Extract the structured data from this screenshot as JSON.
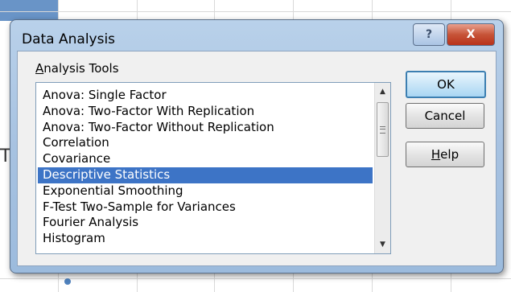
{
  "dialog": {
    "title": "Data Analysis",
    "help_glyph": "?",
    "close_glyph": "X",
    "tools_label_prefix": "",
    "tools_label_mnemonic": "A",
    "tools_label_rest": "nalysis Tools",
    "tools": [
      "Anova: Single Factor",
      "Anova: Two-Factor With Replication",
      "Anova: Two-Factor Without Replication",
      "Correlation",
      "Covariance",
      "Descriptive Statistics",
      "Exponential Smoothing",
      "F-Test Two-Sample for Variances",
      "Fourier Analysis",
      "Histogram"
    ],
    "selected_tool": "Descriptive Statistics",
    "ok_label": "OK",
    "cancel_label": "Cancel",
    "help_label_mnemonic": "H",
    "help_label_rest": "elp"
  },
  "background": {
    "left_glyph": "T"
  },
  "icons": {
    "scroll_up": "up-arrow-icon",
    "scroll_down": "down-arrow-icon"
  },
  "colors": {
    "selection": "#3d74c6",
    "title_bar": "#a7c2e1",
    "close_button": "#c75438"
  }
}
